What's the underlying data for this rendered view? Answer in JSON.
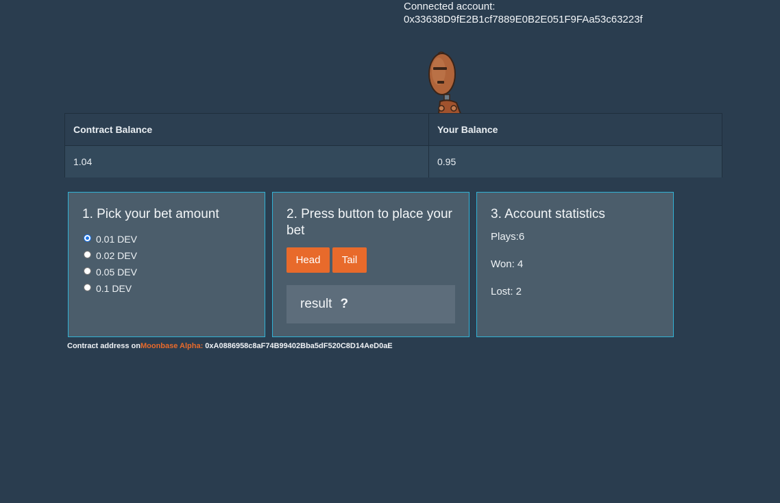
{
  "account": {
    "label": "Connected account:",
    "address": "0x33638D9fE2B1cf7889E0B2E051F9FAa53c63223f"
  },
  "balances": {
    "contract_header": "Contract Balance",
    "your_header": "Your Balance",
    "contract_value": "1.04",
    "your_value": "0.95"
  },
  "bet_panel": {
    "title": "1. Pick your bet amount",
    "options": [
      "0.01 DEV",
      "0.02 DEV",
      "0.05 DEV",
      "0.1 DEV"
    ],
    "selected": "0.01 DEV"
  },
  "place_panel": {
    "title": "2. Press button to place your bet",
    "head_label": "Head",
    "tail_label": "Tail",
    "result_label": "result",
    "result_value": "?"
  },
  "stats_panel": {
    "title": "3. Account statistics",
    "plays": "Plays:6",
    "won": "Won: 4",
    "lost": "Lost: 2"
  },
  "footer": {
    "prefix": "Contract address on",
    "network": "Moonbase Alpha:",
    "address": "0xA0886958c8aF74B99402Bba5dF520C8D14AeD0aE"
  },
  "colors": {
    "background": "#2a3d4f",
    "accent": "#e86a2b",
    "panel_border": "#31b3d6"
  },
  "icons": {
    "mascot": "robot-mascot-icon"
  }
}
